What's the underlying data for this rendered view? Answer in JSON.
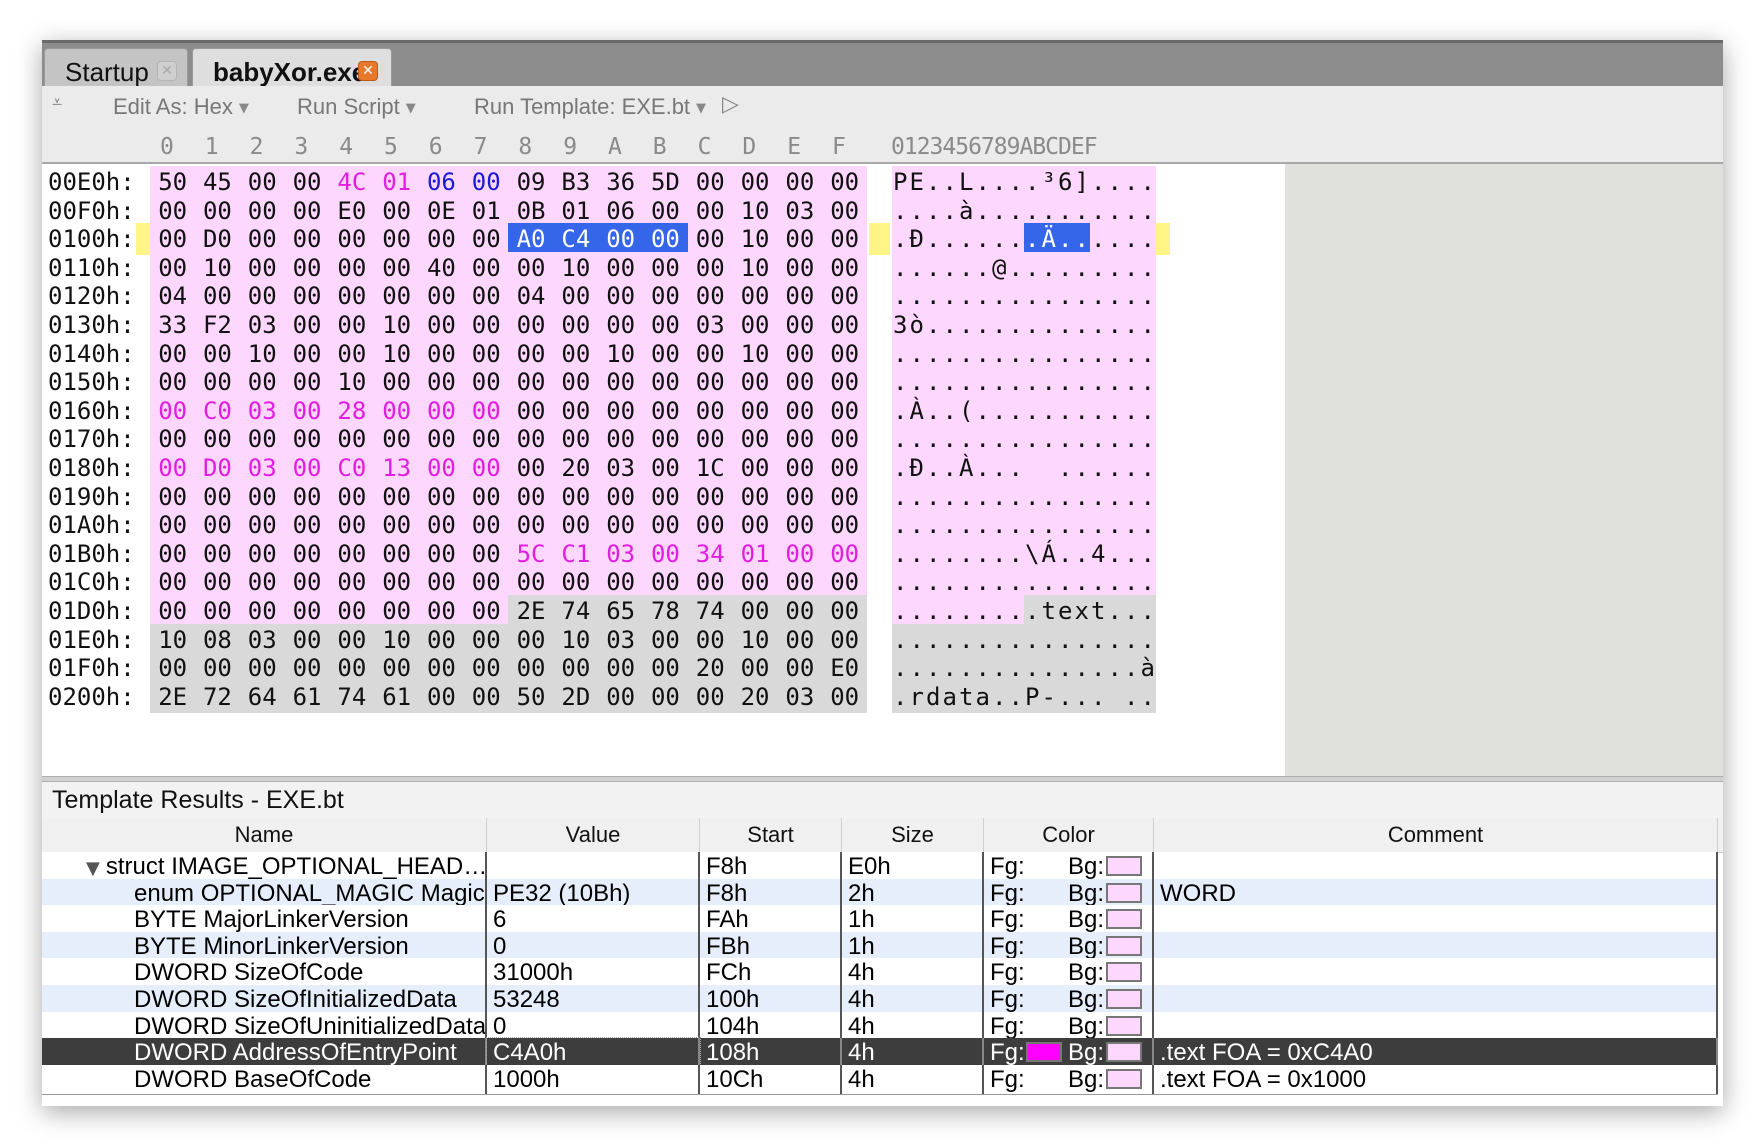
{
  "tabs": [
    {
      "label": "Startup",
      "active": false
    },
    {
      "label": "babyXor.exe",
      "active": true
    }
  ],
  "toolbar": {
    "collapse_icon": "collapse-icon",
    "edit_as": "Edit As: Hex",
    "run_script": "Run Script",
    "run_template": "Run Template: EXE.bt",
    "play_icon": "play-icon"
  },
  "hex": {
    "columns": [
      "0",
      "1",
      "2",
      "3",
      "4",
      "5",
      "6",
      "7",
      "8",
      "9",
      "A",
      "B",
      "C",
      "D",
      "E",
      "F"
    ],
    "ascii_header": "0123456789ABCDEF",
    "rows": [
      {
        "addr": "00E0h:",
        "bytes": [
          "50",
          "45",
          "00",
          "00",
          "4C",
          "01",
          "06",
          "00",
          "09",
          "B3",
          "36",
          "5D",
          "00",
          "00",
          "00",
          "00"
        ],
        "bg": "PPPPPPPPPPPPPPPP",
        "fg": "nnnnmmbbnnnnnnnn",
        "ascii": [
          "P",
          "E",
          ".",
          ".",
          "L",
          ".",
          ".",
          ".",
          ".",
          "³",
          "6",
          "]",
          ".",
          ".",
          ".",
          "."
        ]
      },
      {
        "addr": "00F0h:",
        "bytes": [
          "00",
          "00",
          "00",
          "00",
          "E0",
          "00",
          "0E",
          "01",
          "0B",
          "01",
          "06",
          "00",
          "00",
          "10",
          "03",
          "00"
        ],
        "bg": "PPPPPPPPPPPPPPPP",
        "fg": "nnnnnnnnnnnnnnnn",
        "ascii": [
          ".",
          ".",
          ".",
          ".",
          "à",
          ".",
          ".",
          ".",
          ".",
          ".",
          ".",
          ".",
          ".",
          ".",
          ".",
          "."
        ]
      },
      {
        "addr": "0100h:",
        "bytes": [
          "00",
          "D0",
          "00",
          "00",
          "00",
          "00",
          "00",
          "00",
          "A0",
          "C4",
          "00",
          "00",
          "00",
          "10",
          "00",
          "00"
        ],
        "bg": "PPPPPPPPSSSSPPPP",
        "fg": "nnnnnnnnnnnnnnnn",
        "ascii": [
          ".",
          "Ð",
          ".",
          ".",
          ".",
          ".",
          ".",
          ".",
          ".",
          "Ä",
          ".",
          ".",
          ".",
          ".",
          ".",
          "."
        ]
      },
      {
        "addr": "0110h:",
        "bytes": [
          "00",
          "10",
          "00",
          "00",
          "00",
          "00",
          "40",
          "00",
          "00",
          "10",
          "00",
          "00",
          "00",
          "10",
          "00",
          "00"
        ],
        "bg": "PPPPPPPPPPPPPPPP",
        "fg": "nnnnnnnnnnnnnnnn",
        "ascii": [
          ".",
          ".",
          ".",
          ".",
          ".",
          ".",
          "@",
          ".",
          ".",
          ".",
          ".",
          ".",
          ".",
          ".",
          ".",
          "."
        ]
      },
      {
        "addr": "0120h:",
        "bytes": [
          "04",
          "00",
          "00",
          "00",
          "00",
          "00",
          "00",
          "00",
          "04",
          "00",
          "00",
          "00",
          "00",
          "00",
          "00",
          "00"
        ],
        "bg": "PPPPPPPPPPPPPPPP",
        "fg": "nnnnnnnnnnnnnnnn",
        "ascii": [
          ".",
          ".",
          ".",
          ".",
          ".",
          ".",
          ".",
          ".",
          ".",
          ".",
          ".",
          ".",
          ".",
          ".",
          ".",
          "."
        ]
      },
      {
        "addr": "0130h:",
        "bytes": [
          "33",
          "F2",
          "03",
          "00",
          "00",
          "10",
          "00",
          "00",
          "00",
          "00",
          "00",
          "00",
          "03",
          "00",
          "00",
          "00"
        ],
        "bg": "PPPPPPPPPPPPPPPP",
        "fg": "nnnnnnnnnnnnnnnn",
        "ascii": [
          "3",
          "ò",
          ".",
          ".",
          ".",
          ".",
          ".",
          ".",
          ".",
          ".",
          ".",
          ".",
          ".",
          ".",
          ".",
          "."
        ]
      },
      {
        "addr": "0140h:",
        "bytes": [
          "00",
          "00",
          "10",
          "00",
          "00",
          "10",
          "00",
          "00",
          "00",
          "00",
          "10",
          "00",
          "00",
          "10",
          "00",
          "00"
        ],
        "bg": "PPPPPPPPPPPPPPPP",
        "fg": "nnnnnnnnnnnnnnnn",
        "ascii": [
          ".",
          ".",
          ".",
          ".",
          ".",
          ".",
          ".",
          ".",
          ".",
          ".",
          ".",
          ".",
          ".",
          ".",
          ".",
          "."
        ]
      },
      {
        "addr": "0150h:",
        "bytes": [
          "00",
          "00",
          "00",
          "00",
          "10",
          "00",
          "00",
          "00",
          "00",
          "00",
          "00",
          "00",
          "00",
          "00",
          "00",
          "00"
        ],
        "bg": "PPPPPPPPPPPPPPPP",
        "fg": "nnnnnnnnnnnnnnnn",
        "ascii": [
          ".",
          ".",
          ".",
          ".",
          ".",
          ".",
          ".",
          ".",
          ".",
          ".",
          ".",
          ".",
          ".",
          ".",
          ".",
          "."
        ]
      },
      {
        "addr": "0160h:",
        "bytes": [
          "00",
          "C0",
          "03",
          "00",
          "28",
          "00",
          "00",
          "00",
          "00",
          "00",
          "00",
          "00",
          "00",
          "00",
          "00",
          "00"
        ],
        "bg": "PPPPPPPPPPPPPPPP",
        "fg": "mmmmmmmmnnnnnnnn",
        "ascii": [
          ".",
          "À",
          ".",
          ".",
          "(",
          ".",
          ".",
          ".",
          ".",
          ".",
          ".",
          ".",
          ".",
          ".",
          ".",
          "."
        ]
      },
      {
        "addr": "0170h:",
        "bytes": [
          "00",
          "00",
          "00",
          "00",
          "00",
          "00",
          "00",
          "00",
          "00",
          "00",
          "00",
          "00",
          "00",
          "00",
          "00",
          "00"
        ],
        "bg": "PPPPPPPPPPPPPPPP",
        "fg": "nnnnnnnnnnnnnnnn",
        "ascii": [
          ".",
          ".",
          ".",
          ".",
          ".",
          ".",
          ".",
          ".",
          ".",
          ".",
          ".",
          ".",
          ".",
          ".",
          ".",
          "."
        ]
      },
      {
        "addr": "0180h:",
        "bytes": [
          "00",
          "D0",
          "03",
          "00",
          "C0",
          "13",
          "00",
          "00",
          "00",
          "20",
          "03",
          "00",
          "1C",
          "00",
          "00",
          "00"
        ],
        "bg": "PPPPPPPPPPPPPPPP",
        "fg": "mmmmmmmmnnnnnnnn",
        "ascii": [
          ".",
          "Ð",
          ".",
          ".",
          "À",
          ".",
          ".",
          ".",
          " ",
          " ",
          ".",
          ".",
          ".",
          ".",
          ".",
          "."
        ]
      },
      {
        "addr": "0190h:",
        "bytes": [
          "00",
          "00",
          "00",
          "00",
          "00",
          "00",
          "00",
          "00",
          "00",
          "00",
          "00",
          "00",
          "00",
          "00",
          "00",
          "00"
        ],
        "bg": "PPPPPPPPPPPPPPPP",
        "fg": "nnnnnnnnnnnnnnnn",
        "ascii": [
          ".",
          ".",
          ".",
          ".",
          ".",
          ".",
          ".",
          ".",
          ".",
          ".",
          ".",
          ".",
          ".",
          ".",
          ".",
          "."
        ]
      },
      {
        "addr": "01A0h:",
        "bytes": [
          "00",
          "00",
          "00",
          "00",
          "00",
          "00",
          "00",
          "00",
          "00",
          "00",
          "00",
          "00",
          "00",
          "00",
          "00",
          "00"
        ],
        "bg": "PPPPPPPPPPPPPPPP",
        "fg": "nnnnnnnnnnnnnnnn",
        "ascii": [
          ".",
          ".",
          ".",
          ".",
          ".",
          ".",
          ".",
          ".",
          ".",
          ".",
          ".",
          ".",
          ".",
          ".",
          ".",
          "."
        ]
      },
      {
        "addr": "01B0h:",
        "bytes": [
          "00",
          "00",
          "00",
          "00",
          "00",
          "00",
          "00",
          "00",
          "5C",
          "C1",
          "03",
          "00",
          "34",
          "01",
          "00",
          "00"
        ],
        "bg": "PPPPPPPPPPPPPPPP",
        "fg": "nnnnnnnnmmmmmmmm",
        "ascii": [
          ".",
          ".",
          ".",
          ".",
          ".",
          ".",
          ".",
          ".",
          "\\",
          "Á",
          ".",
          ".",
          "4",
          ".",
          ".",
          "."
        ]
      },
      {
        "addr": "01C0h:",
        "bytes": [
          "00",
          "00",
          "00",
          "00",
          "00",
          "00",
          "00",
          "00",
          "00",
          "00",
          "00",
          "00",
          "00",
          "00",
          "00",
          "00"
        ],
        "bg": "PPPPPPPPPPPPPPPP",
        "fg": "nnnnnnnnnnnnnnnn",
        "ascii": [
          ".",
          ".",
          ".",
          ".",
          ".",
          ".",
          ".",
          ".",
          ".",
          ".",
          ".",
          ".",
          ".",
          ".",
          ".",
          "."
        ]
      },
      {
        "addr": "01D0h:",
        "bytes": [
          "00",
          "00",
          "00",
          "00",
          "00",
          "00",
          "00",
          "00",
          "2E",
          "74",
          "65",
          "78",
          "74",
          "00",
          "00",
          "00"
        ],
        "bg": "PPPPPPPPGGGGGGGG",
        "fg": "nnnnnnnnnnnnnnnn",
        "ascii": [
          ".",
          ".",
          ".",
          ".",
          ".",
          ".",
          ".",
          ".",
          ".",
          "t",
          "e",
          "x",
          "t",
          ".",
          ".",
          "."
        ]
      },
      {
        "addr": "01E0h:",
        "bytes": [
          "10",
          "08",
          "03",
          "00",
          "00",
          "10",
          "00",
          "00",
          "00",
          "10",
          "03",
          "00",
          "00",
          "10",
          "00",
          "00"
        ],
        "bg": "GGGGGGGGGGGGGGGG",
        "fg": "nnnnnnnnnnnnnnnn",
        "ascii": [
          ".",
          ".",
          ".",
          ".",
          ".",
          ".",
          ".",
          ".",
          ".",
          ".",
          ".",
          ".",
          ".",
          ".",
          ".",
          "."
        ]
      },
      {
        "addr": "01F0h:",
        "bytes": [
          "00",
          "00",
          "00",
          "00",
          "00",
          "00",
          "00",
          "00",
          "00",
          "00",
          "00",
          "00",
          "20",
          "00",
          "00",
          "E0"
        ],
        "bg": "GGGGGGGGGGGGGGGG",
        "fg": "nnnnnnnnnnnnnnnn",
        "ascii": [
          ".",
          ".",
          ".",
          ".",
          ".",
          ".",
          ".",
          ".",
          ".",
          ".",
          ".",
          ".",
          ".",
          ".",
          ".",
          "à"
        ]
      },
      {
        "addr": "0200h:",
        "bytes": [
          "2E",
          "72",
          "64",
          "61",
          "74",
          "61",
          "00",
          "00",
          "50",
          "2D",
          "00",
          "00",
          "00",
          "20",
          "03",
          "00"
        ],
        "bg": "GGGGGGGGGGGGGGGG",
        "fg": "nnnnnnnnnnnnnnnn",
        "ascii": [
          ".",
          "r",
          "d",
          "a",
          "t",
          "a",
          ".",
          ".",
          "P",
          "-",
          ".",
          ".",
          ".",
          " ",
          ".",
          "."
        ]
      }
    ]
  },
  "results": {
    "title": "Template Results - EXE.bt",
    "columns": [
      "Name",
      "Value",
      "Start",
      "Size",
      "Color",
      "Comment"
    ],
    "fg_label": "Fg:",
    "bg_label": "Bg:",
    "rows": [
      {
        "name": "struct IMAGE_OPTIONAL_HEAD…",
        "value": "",
        "start": "F8h",
        "size": "E0h",
        "comment": "",
        "indent": 1,
        "expanded": true
      },
      {
        "name": "enum OPTIONAL_MAGIC Magic",
        "value": "PE32 (10Bh)",
        "start": "F8h",
        "size": "2h",
        "comment": "WORD",
        "indent": 2
      },
      {
        "name": "BYTE MajorLinkerVersion",
        "value": "6",
        "start": "FAh",
        "size": "1h",
        "comment": "",
        "indent": 2
      },
      {
        "name": "BYTE MinorLinkerVersion",
        "value": "0",
        "start": "FBh",
        "size": "1h",
        "comment": "",
        "indent": 2
      },
      {
        "name": "DWORD SizeOfCode",
        "value": "31000h",
        "start": "FCh",
        "size": "4h",
        "comment": "",
        "indent": 2
      },
      {
        "name": "DWORD SizeOfInitializedData",
        "value": "53248",
        "start": "100h",
        "size": "4h",
        "comment": "",
        "indent": 2
      },
      {
        "name": "DWORD SizeOfUninitializedData",
        "value": "0",
        "start": "104h",
        "size": "4h",
        "comment": "",
        "indent": 2
      },
      {
        "name": "DWORD AddressOfEntryPoint",
        "value": "C4A0h",
        "start": "108h",
        "size": "4h",
        "comment": ".text FOA = 0xC4A0",
        "indent": 2,
        "selected": true
      },
      {
        "name": "DWORD BaseOfCode",
        "value": "1000h",
        "start": "10Ch",
        "size": "4h",
        "comment": ".text FOA = 0x1000",
        "indent": 2
      }
    ]
  },
  "colors": {
    "pink_highlight": "#fdd7fd",
    "gray_highlight": "#d9d9d9",
    "selection_blue": "#3565e8",
    "magenta_text": "#e21de2",
    "blue_text": "#1a1ad6",
    "active_tab_close": "#e8782b",
    "fg_swatch": "#ff00ff"
  }
}
